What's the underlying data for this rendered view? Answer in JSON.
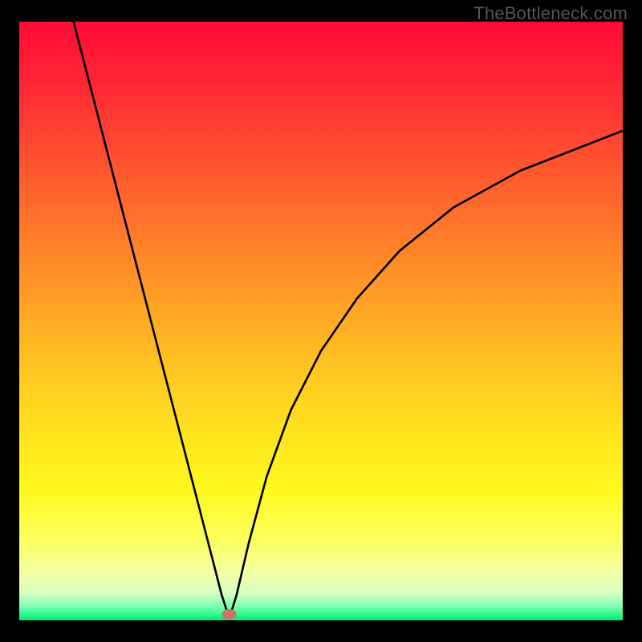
{
  "watermark": "TheBottleneck.com",
  "colors": {
    "frame": "#000000",
    "curve": "#000000",
    "marker_fill": "#c8746b",
    "gradient_stops": [
      {
        "offset": 0.0,
        "color": "#ff0b35"
      },
      {
        "offset": 0.1,
        "color": "#ff2634"
      },
      {
        "offset": 0.2,
        "color": "#ff4730"
      },
      {
        "offset": 0.3,
        "color": "#ff682c"
      },
      {
        "offset": 0.4,
        "color": "#ff8a28"
      },
      {
        "offset": 0.5,
        "color": "#ffab24"
      },
      {
        "offset": 0.6,
        "color": "#ffcb20"
      },
      {
        "offset": 0.7,
        "color": "#ffe61e"
      },
      {
        "offset": 0.78,
        "color": "#fff81e"
      },
      {
        "offset": 0.86,
        "color": "#fdff58"
      },
      {
        "offset": 0.92,
        "color": "#f4ffa4"
      },
      {
        "offset": 0.955,
        "color": "#d6ffc4"
      },
      {
        "offset": 0.975,
        "color": "#86ffb2"
      },
      {
        "offset": 0.99,
        "color": "#2cf990"
      },
      {
        "offset": 1.0,
        "color": "#07e876"
      }
    ]
  },
  "chart_data": {
    "type": "line",
    "title": "",
    "xlabel": "",
    "ylabel": "",
    "xlim": [
      0,
      100
    ],
    "ylim": [
      0,
      100
    ],
    "marker": {
      "x": 34.8,
      "y": 1.0,
      "rx": 1.2,
      "ry": 0.9
    },
    "series": [
      {
        "name": "bottleneck-curve",
        "x": [
          9.0,
          12,
          15,
          18,
          21,
          24,
          27,
          30,
          32,
          33.5,
          34.8,
          36,
          38,
          41,
          45,
          50,
          56,
          63,
          72,
          83,
          99.8
        ],
        "y": [
          100,
          88.3,
          76.6,
          64.9,
          53.2,
          41.5,
          29.8,
          18.1,
          10.3,
          4.4,
          0.3,
          4.2,
          12.8,
          24.0,
          35.1,
          45.0,
          53.8,
          61.7,
          69.0,
          75.1,
          81.7
        ]
      }
    ]
  }
}
